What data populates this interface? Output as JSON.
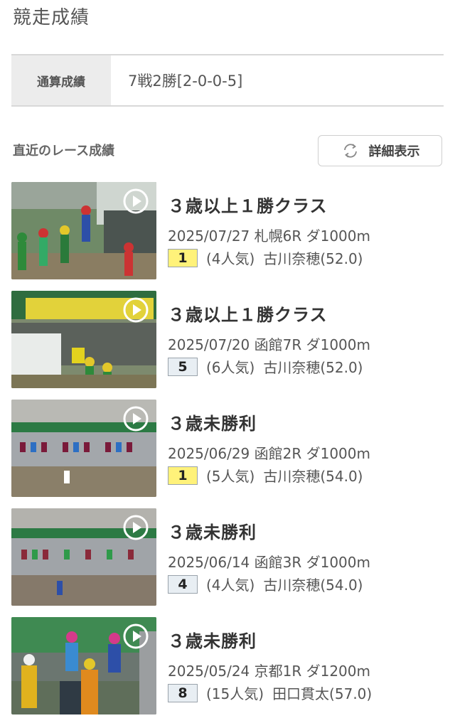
{
  "page_title": "競走成績",
  "summary": {
    "label": "通算成績",
    "value": "7戦2勝[2-0-0-5]"
  },
  "section_title": "直近のレース成績",
  "detail_button_label": "詳細表示",
  "colors": {
    "win_badge": "#fff27a",
    "other_badge": "#e8eef3"
  },
  "races": [
    {
      "name": "３歳以上１勝クラス",
      "meta": "2025/07/27 札幌6R ダ1000m",
      "rank": "1",
      "popularity": "(4人気)",
      "jockey": "古川奈穂(52.0)"
    },
    {
      "name": "３歳以上１勝クラス",
      "meta": "2025/07/20 函館7R ダ1000m",
      "rank": "5",
      "popularity": "(6人気)",
      "jockey": "古川奈穂(52.0)"
    },
    {
      "name": "３歳未勝利",
      "meta": "2025/06/29 函館2R ダ1000m",
      "rank": "1",
      "popularity": "(5人気)",
      "jockey": "古川奈穂(54.0)"
    },
    {
      "name": "３歳未勝利",
      "meta": "2025/06/14 函館3R ダ1000m",
      "rank": "4",
      "popularity": "(4人気)",
      "jockey": "古川奈穂(54.0)"
    },
    {
      "name": "３歳未勝利",
      "meta": "2025/05/24 京都1R ダ1200m",
      "rank": "8",
      "popularity": "(15人気)",
      "jockey": "田口貫太(57.0)"
    }
  ]
}
